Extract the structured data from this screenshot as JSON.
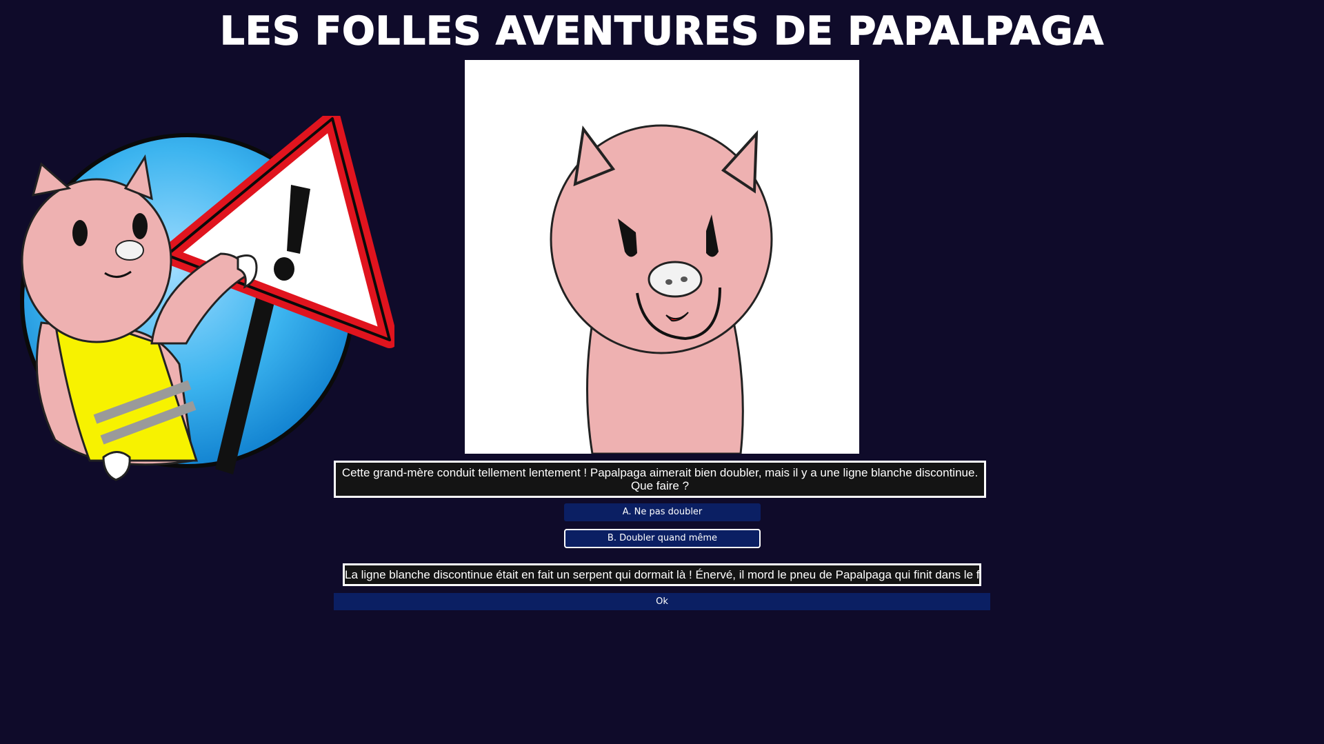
{
  "header": {
    "title": "Les folles aventures de Papalpaga"
  },
  "images": {
    "mascot_icon": "alpaca-with-warning-sign-icon",
    "scene_icon": "angry-alpaca-icon"
  },
  "question": {
    "text": "Cette grand-mère conduit tellement lentement ! Papalpaga aimerait bien doubler, mais il y a une ligne blanche discontinue. Que faire ?"
  },
  "choices": [
    {
      "label": "A. Ne pas doubler"
    },
    {
      "label": "B. Doubler quand même"
    }
  ],
  "result": {
    "text": "La ligne blanche discontinue était en fait un serpent qui dormait là ! Énervé, il mord le pneu de Papalpaga qui finit dans le fossé !"
  },
  "ok_button": {
    "label": "Ok"
  },
  "colors": {
    "background": "#0f0b2a",
    "button": "#0b1f63",
    "alpaca_pink": "#eeb1b1",
    "vest_yellow": "#f7f200",
    "sign_red": "#e0141e",
    "circle_blue": "#3cb4ef"
  }
}
